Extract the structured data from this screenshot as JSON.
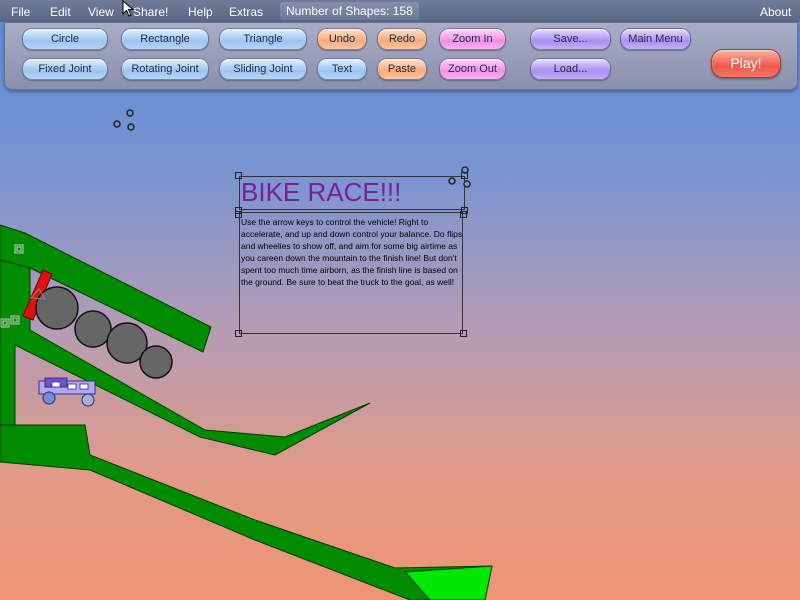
{
  "menu": {
    "file": "File",
    "edit": "Edit",
    "view": "View",
    "share": "Share!",
    "help": "Help",
    "extras": "Extras",
    "about": "About"
  },
  "status": {
    "shape_count": "Number of Shapes: 158"
  },
  "toolbar": {
    "circle": "Circle",
    "rectangle": "Rectangle",
    "triangle": "Triangle",
    "undo": "Undo",
    "redo": "Redo",
    "zoom_in": "Zoom In",
    "save": "Save...",
    "main_menu": "Main Menu",
    "fixed_joint": "Fixed Joint",
    "rotating_joint": "Rotating Joint",
    "sliding_joint": "Sliding Joint",
    "text": "Text",
    "paste": "Paste",
    "zoom_out": "Zoom Out",
    "load": "Load...",
    "play": "Play!"
  },
  "level": {
    "title": "BIKE RACE!!!",
    "instructions": "Use the arrow keys to control the vehicle!  Right to accelerate, and up and down control your balance. Do flips and wheelies to show off, and aim for some big airtime as you careen down the mountain to the finish line! But don't spent too much time airborn, as the finish line is based on the ground. Be sure to beat the truck to the goal, as well!"
  },
  "colors": {
    "ground": "#008c00",
    "ground_light": "#00e800",
    "rock": "#666666",
    "title": "#7a1f9c",
    "truck": "#5a3fb0",
    "red_bar": "#e01010"
  }
}
